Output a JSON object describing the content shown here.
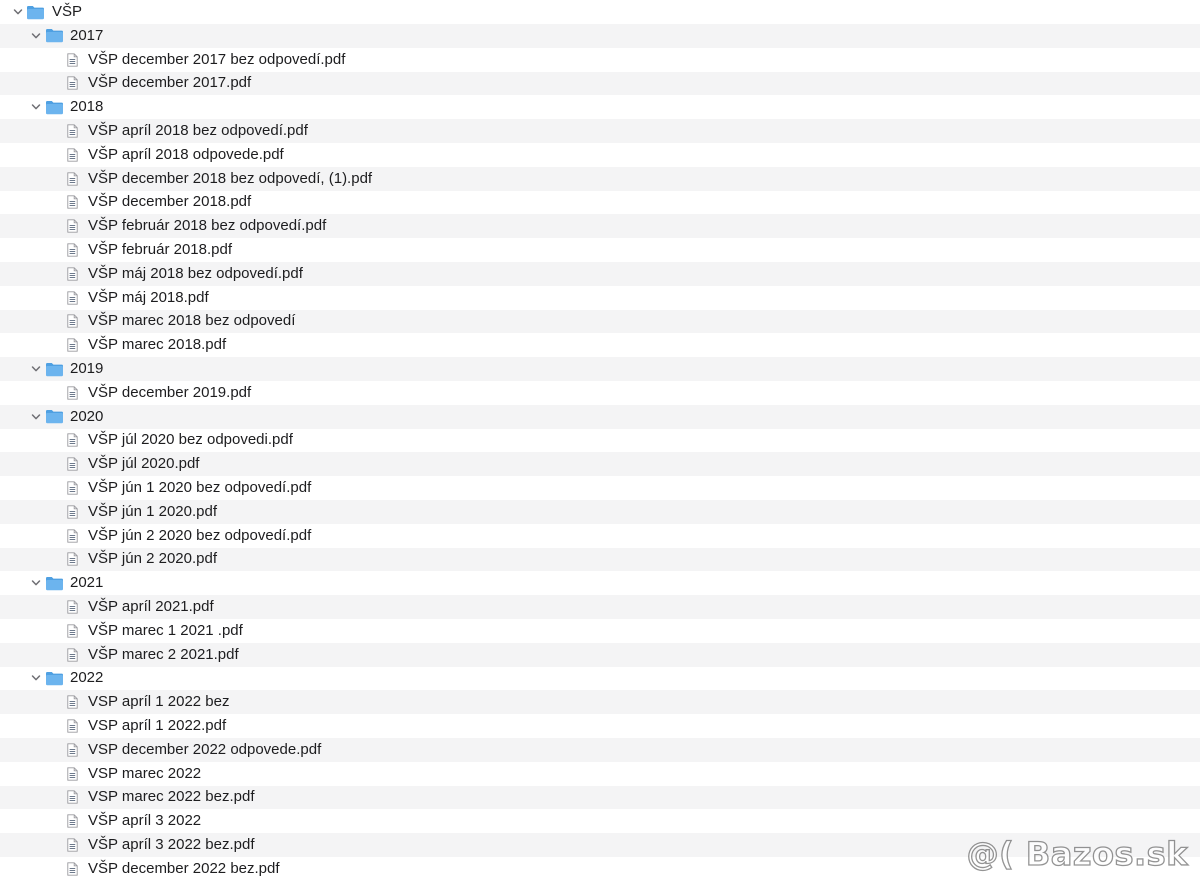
{
  "root": {
    "label": "VŠP",
    "icon": "folder-icon",
    "expanded": true
  },
  "folders": [
    {
      "label": "2017",
      "files": [
        "VŠP december 2017 bez odpovedí.pdf",
        "VŠP december 2017.pdf"
      ]
    },
    {
      "label": "2018",
      "files": [
        "VŠP apríl 2018 bez odpovedí.pdf",
        "VŠP apríl 2018 odpovede.pdf",
        "VŠP december 2018 bez odpovedí, (1).pdf",
        "VŠP december 2018.pdf",
        "VŠP február 2018 bez odpovedí.pdf",
        "VŠP február 2018.pdf",
        "VŠP máj 2018 bez odpovedí.pdf",
        "VŠP máj 2018.pdf",
        "VŠP marec 2018 bez odpovedí",
        "VŠP marec 2018.pdf"
      ]
    },
    {
      "label": "2019",
      "files": [
        "VŠP december 2019.pdf"
      ]
    },
    {
      "label": "2020",
      "files": [
        "VŠP júl 2020 bez odpovedi.pdf",
        "VŠP júl 2020.pdf",
        "VŠP jún 1 2020 bez odpovedí.pdf",
        "VŠP jún 1 2020.pdf",
        "VŠP jún 2 2020 bez odpovedí.pdf",
        "VŠP jún 2 2020.pdf"
      ]
    },
    {
      "label": "2021",
      "files": [
        "VŠP apríl 2021.pdf",
        "VŠP marec 1 2021 .pdf",
        "VŠP marec 2 2021.pdf"
      ]
    },
    {
      "label": "2022",
      "files": [
        "VSP apríl 1 2022 bez",
        "VSP apríl 1 2022.pdf",
        "VSP december 2022 odpovede.pdf",
        "VSP marec 2022",
        "VSP marec 2022 bez.pdf",
        "VŠP apríl 3 2022",
        "VŠP apríl 3 2022 bez.pdf",
        "VŠP december 2022 bez.pdf"
      ]
    }
  ],
  "watermark": "@( Bazos.sk",
  "colors": {
    "folder": "#6cb4ee",
    "folder_tab": "#4fa0e2",
    "stripe": "#f4f4f5",
    "text": "#1d1d1f",
    "chevron": "#6e6e73"
  }
}
